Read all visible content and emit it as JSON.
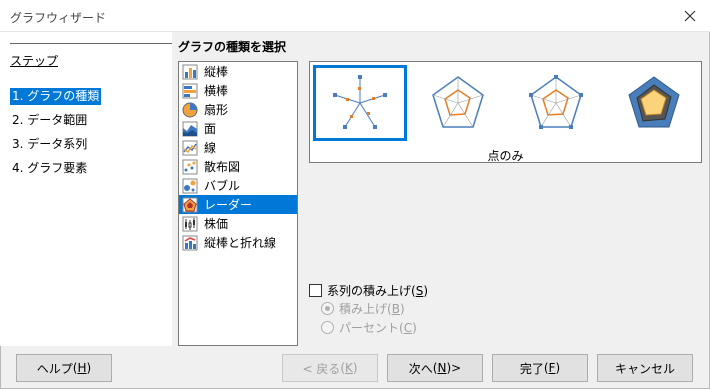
{
  "window": {
    "title": "グラフウィザード"
  },
  "steps": {
    "heading": "ステップ",
    "items": [
      {
        "label": "1. グラフの種類",
        "active": true
      },
      {
        "label": "2. データ範囲",
        "active": false
      },
      {
        "label": "3. データ系列",
        "active": false
      },
      {
        "label": "4. グラフ要素",
        "active": false
      }
    ]
  },
  "chart_type": {
    "section_title": "グラフの種類を選択",
    "types": [
      {
        "label": "縦棒",
        "icon": "column-chart-icon"
      },
      {
        "label": "横棒",
        "icon": "bar-chart-icon"
      },
      {
        "label": "扇形",
        "icon": "pie-chart-icon"
      },
      {
        "label": "面",
        "icon": "area-chart-icon"
      },
      {
        "label": "線",
        "icon": "line-chart-icon"
      },
      {
        "label": "散布図",
        "icon": "scatter-chart-icon"
      },
      {
        "label": "バブル",
        "icon": "bubble-chart-icon"
      },
      {
        "label": "レーダー",
        "icon": "radar-chart-icon",
        "selected": true
      },
      {
        "label": "株価",
        "icon": "stock-chart-icon"
      },
      {
        "label": "縦棒と折れ線",
        "icon": "column-line-chart-icon"
      }
    ],
    "variant_label": "点のみ",
    "variants": [
      "radar-points-only",
      "radar-lines",
      "radar-lines-and-points",
      "radar-filled"
    ],
    "stack_series_label": "系列の積み上げ",
    "stack_series_key": "S",
    "stack_label": "積み上げ",
    "stack_key": "B",
    "percent_label": "パーセント",
    "percent_key": "C"
  },
  "buttons": {
    "help": "ヘルプ",
    "help_key": "H",
    "back": "< 戻る",
    "back_key": "K",
    "next": "次へ",
    "next_key": "N",
    "next_suffix": " >",
    "finish": "完了",
    "finish_key": "F",
    "cancel": "キャンセル"
  },
  "colors": {
    "accent": "#0078d7",
    "radar_line": "#4a7ebb",
    "radar_series": "#e87c21",
    "radar_fill": "#fbd37b"
  }
}
